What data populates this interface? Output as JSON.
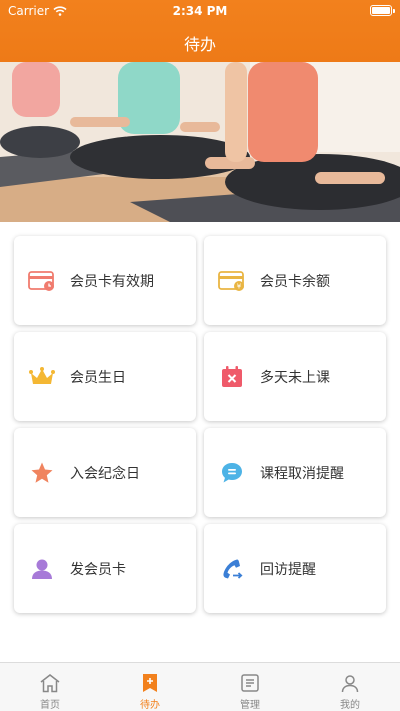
{
  "status": {
    "carrier": "Carrier",
    "time": "2:34 PM"
  },
  "nav": {
    "title": "待办"
  },
  "cards": [
    {
      "label": "会员卡有效期",
      "icon": "card-clock-icon"
    },
    {
      "label": "会员卡余额",
      "icon": "card-coin-icon"
    },
    {
      "label": "会员生日",
      "icon": "crown-icon"
    },
    {
      "label": "多天未上课",
      "icon": "calendar-x-icon"
    },
    {
      "label": "入会纪念日",
      "icon": "star-icon"
    },
    {
      "label": "课程取消提醒",
      "icon": "chat-bubble-icon"
    },
    {
      "label": "发会员卡",
      "icon": "person-icon"
    },
    {
      "label": "回访提醒",
      "icon": "phone-return-icon"
    }
  ],
  "tabs": [
    {
      "label": "首页",
      "icon": "home-icon"
    },
    {
      "label": "待办",
      "icon": "bookmark-plus-icon",
      "active": true
    },
    {
      "label": "管理",
      "icon": "manage-icon"
    },
    {
      "label": "我的",
      "icon": "profile-icon"
    }
  ],
  "colors": {
    "accent": "#f2811d"
  }
}
